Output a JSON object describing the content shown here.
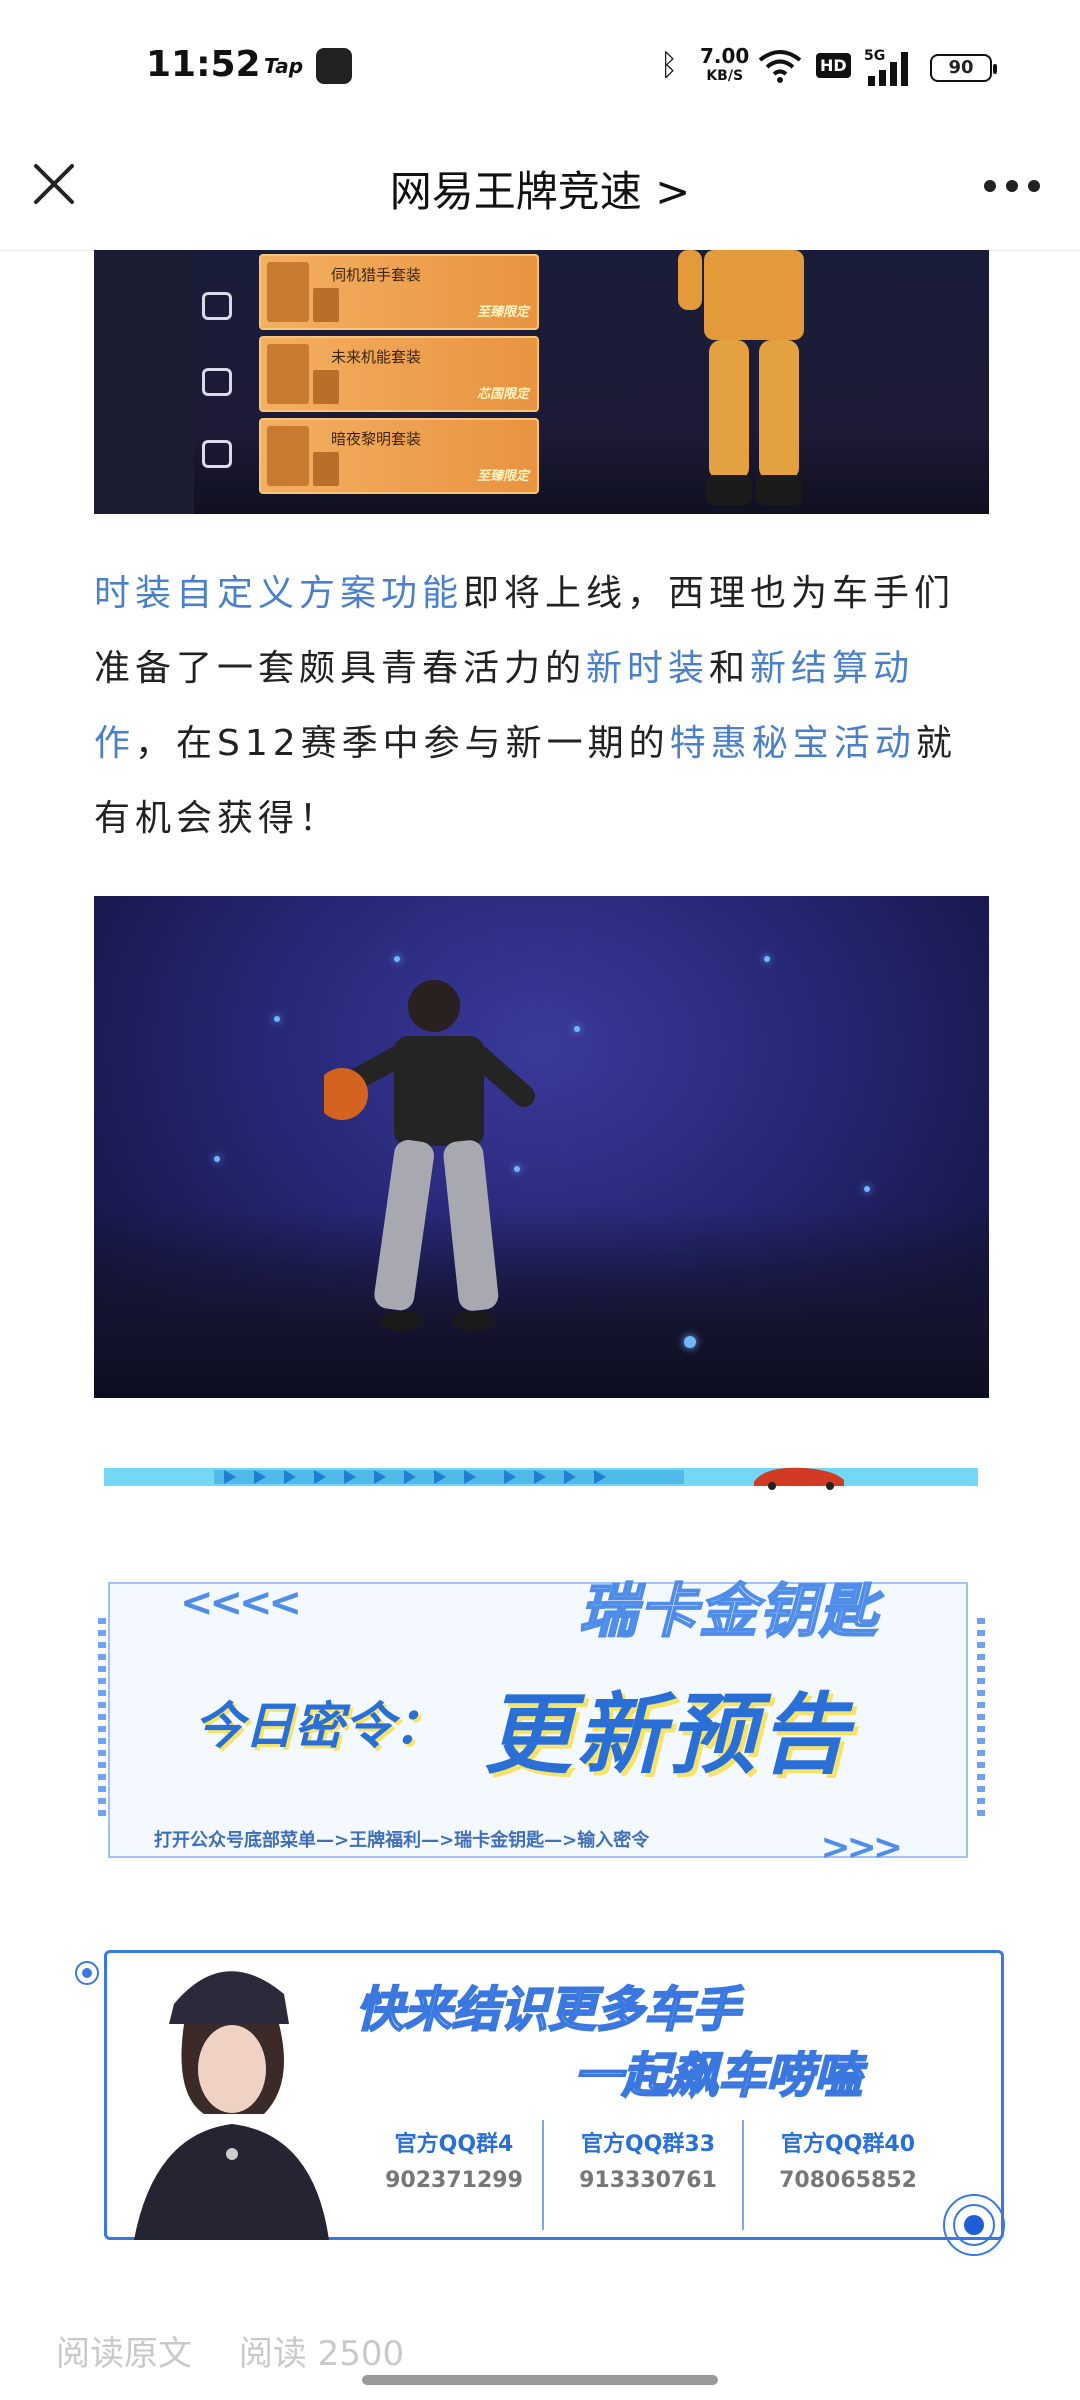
{
  "status_bar": {
    "time": "11:52",
    "app_badge": "Tap",
    "net_speed_value": "7.00",
    "net_speed_unit": "KB/S",
    "hd_label": "HD",
    "network": "5G",
    "battery": "90"
  },
  "header": {
    "title": "网易王牌竞速 >"
  },
  "top_image": {
    "cards": [
      {
        "label": "伺机猎手套装",
        "tag": "至臻限定"
      },
      {
        "label": "未来机能套装",
        "tag": "芯国限定"
      },
      {
        "label": "暗夜黎明套装",
        "tag": "至臻限定"
      }
    ]
  },
  "paragraph": {
    "p1_hl1": "时装自定义方案功能",
    "p1_t1": "即将上线，西理也为车手们准备了一套颇具青春活力的",
    "p1_hl2": "新时装",
    "p1_t2": "和",
    "p1_hl3": "新结算动作",
    "p1_t3": "，在S12赛季中参与新一期的",
    "p1_hl4": "特惠秘宝活动",
    "p1_t4": "就有机会获得！"
  },
  "banner_code": {
    "title": "瑞卡金钥匙",
    "label": "今日密令：",
    "code": "更新预告",
    "hint": "打开公众号底部菜单—>王牌福利—>瑞卡金钥匙—>输入密令"
  },
  "banner_qq": {
    "title_line1": "快来结识更多车手",
    "title_line2": "一起飙车唠嗑",
    "groups": [
      {
        "name": "官方QQ群4",
        "number": "902371299"
      },
      {
        "name": "官方QQ群33",
        "number": "913330761"
      },
      {
        "name": "官方QQ群40",
        "number": "708065852"
      }
    ]
  },
  "footer": {
    "read_original": "阅读原文",
    "read_count": "阅读 2500"
  },
  "colors": {
    "accent_link": "#4a7fc9",
    "banner_blue": "#2a6fd6",
    "banner_yellow": "#f5e36a"
  }
}
